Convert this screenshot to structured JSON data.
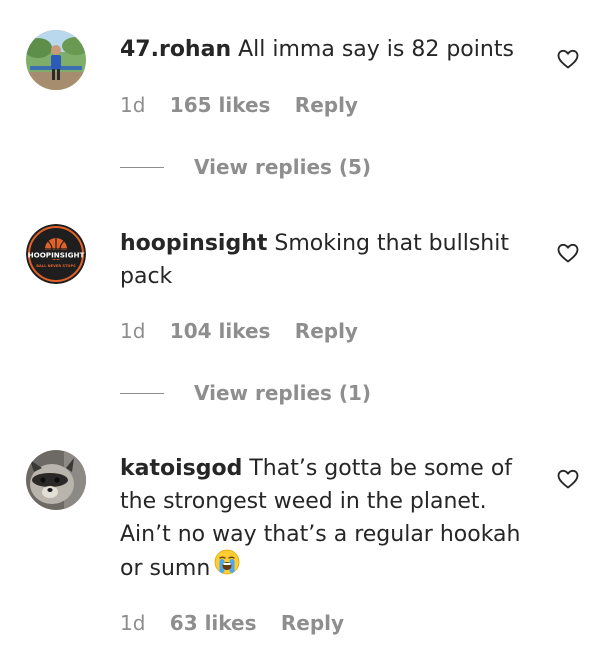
{
  "comments": [
    {
      "username": "47.rohan",
      "text": "All imma say is 82 points",
      "time": "1d",
      "likes": "165 likes",
      "reply": "Reply",
      "view_replies": "View replies (5)",
      "avatar_icon": "boy-outdoors-photo"
    },
    {
      "username": "hoopinsight",
      "text": "Smoking that bullshit pack",
      "time": "1d",
      "likes": "104 likes",
      "reply": "Reply",
      "view_replies": "View replies (1)",
      "avatar_icon": "hoopinsight-logo",
      "avatar_logo_text": "HOOPINSIGHT",
      "avatar_logo_subtext": "BALL NEVER STOPS"
    },
    {
      "username": "katoisgod",
      "text": "That’s gotta be some of the strongest weed in the planet. Ain’t no way that’s a regular hookah or sumn",
      "emoji": "loudly-crying-face-emoji",
      "time": "1d",
      "likes": "63 likes",
      "reply": "Reply",
      "avatar_icon": "raccoon-photo"
    }
  ],
  "colors": {
    "text": "#262626",
    "secondary": "#8e8e8e",
    "background": "#ffffff"
  },
  "icons": {
    "like": "heart-outline-icon"
  }
}
